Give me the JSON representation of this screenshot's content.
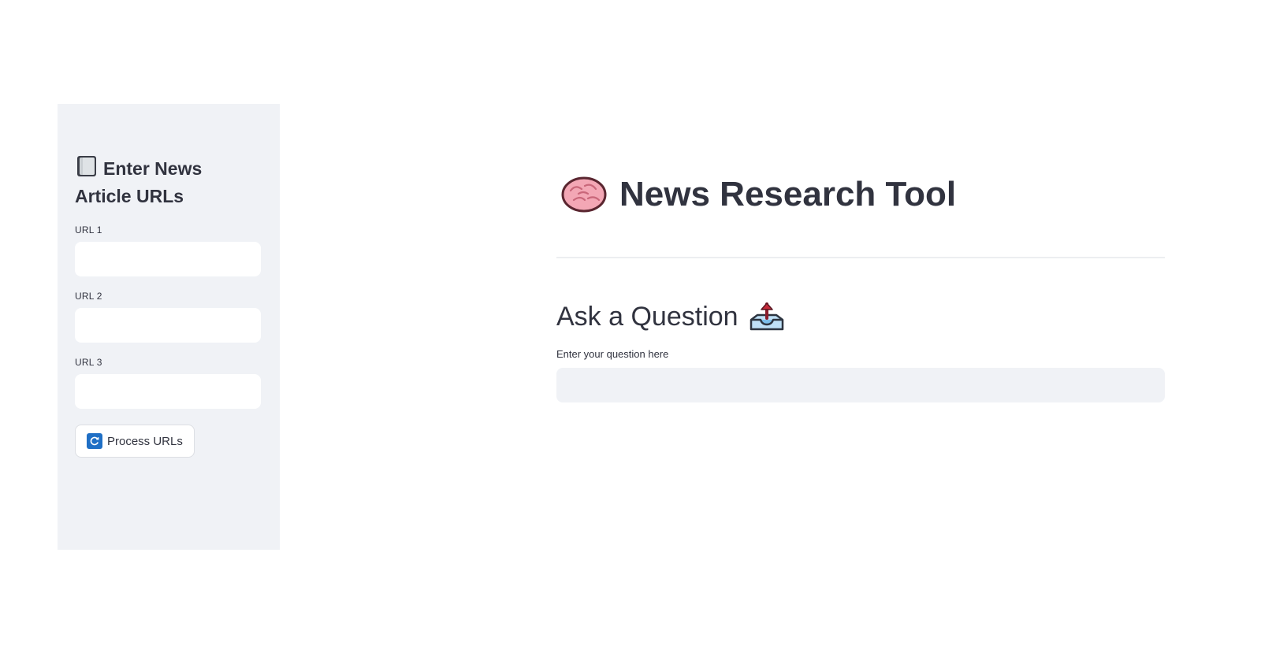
{
  "sidebar": {
    "header": "Enter News Article URLs",
    "header_icon": "notebook-icon",
    "fields": [
      {
        "label": "URL 1",
        "value": "",
        "placeholder": ""
      },
      {
        "label": "URL 2",
        "value": "",
        "placeholder": ""
      },
      {
        "label": "URL 3",
        "value": "",
        "placeholder": ""
      }
    ],
    "process_button": {
      "label": "Process URLs",
      "icon": "refresh-icon"
    }
  },
  "main": {
    "title": "News Research Tool",
    "title_icon": "brain-icon",
    "subheader": "Ask a Question",
    "subheader_icon": "inbox-tray-icon",
    "question": {
      "label": "Enter your question here",
      "value": "",
      "placeholder": ""
    }
  },
  "colors": {
    "sidebar_bg": "#f0f2f6",
    "text": "#31333f",
    "input_bg_main": "#f0f2f6",
    "button_accent": "#1f6fc5"
  }
}
